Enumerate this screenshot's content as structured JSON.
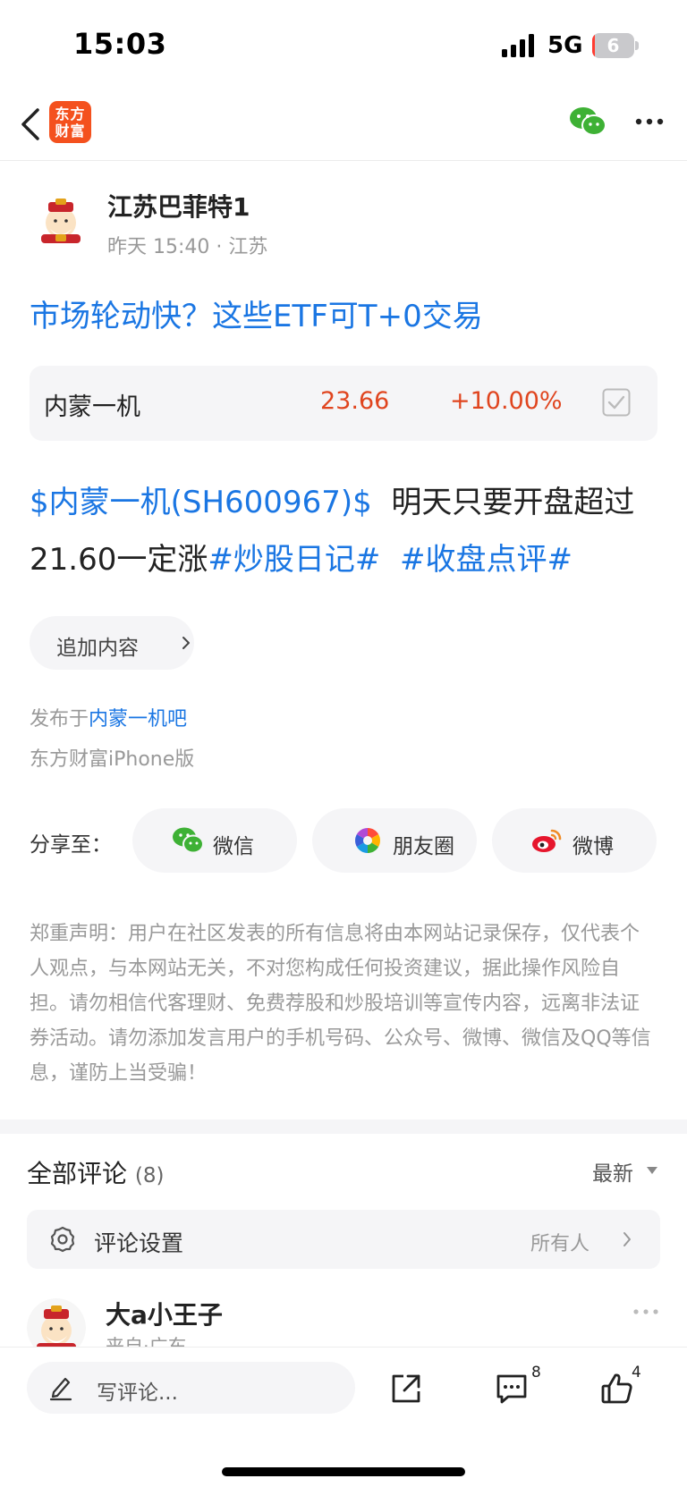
{
  "status_bar": {
    "time": "15:03",
    "network": "5G",
    "battery_level": "6",
    "battery_fraction": 0.06
  },
  "nav": {
    "logo_text": "东方财富"
  },
  "author": {
    "name": "江苏巴菲特1",
    "time": "昨天 15:40",
    "location": "江苏"
  },
  "post": {
    "title": "市场轮动快？这些ETF可T+0交易",
    "stock_card": {
      "name": "内蒙一机",
      "price": "23.66",
      "change": "+10.00%"
    },
    "body": {
      "stock_link": "$内蒙一机(SH600967)$",
      "text": "明天只要开盘超过21.60一定涨",
      "tag1": "#炒股日记#",
      "tag2": "#收盘点评#"
    },
    "add_content_label": "追加内容",
    "published_prefix": "发布于",
    "published_bar": "内蒙一机吧",
    "platform": "东方财富iPhone版"
  },
  "share": {
    "label": "分享至：",
    "wechat": "微信",
    "moments": "朋友圈",
    "weibo": "微博"
  },
  "disclaimer": "郑重声明：用户在社区发表的所有信息将由本网站记录保存，仅代表个人观点，与本网站无关，不对您构成任何投资建议，据此操作风险自担。请勿相信代客理财、免费荐股和炒股培训等宣传内容，远离非法证券活动。请勿添加发言用户的手机号码、公众号、微博、微信及QQ等信息，谨防上当受骗！",
  "comments": {
    "title": "全部评论",
    "count": "(8)",
    "sort": "最新",
    "settings_label": "评论设置",
    "settings_value": "所有人",
    "first": {
      "name": "大a小王子",
      "meta": "来自·广东"
    }
  },
  "bottom_bar": {
    "input_placeholder": "写评论...",
    "comment_count": "8",
    "like_count": "4"
  },
  "colors": {
    "link": "#1a76e3",
    "up": "#e0451f",
    "logo": "#f4511e",
    "wechat": "#3eb135"
  }
}
